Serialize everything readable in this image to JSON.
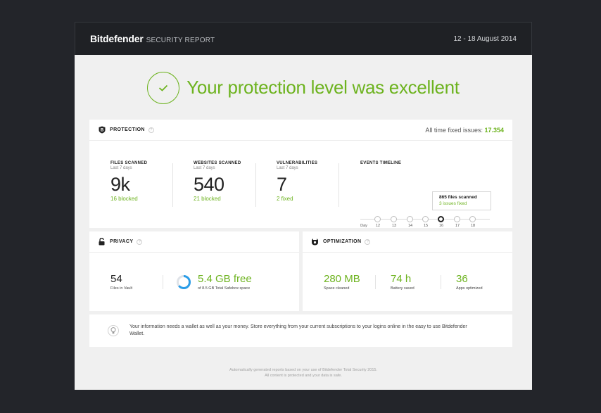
{
  "header": {
    "brand": "Bitdefender",
    "subtitle": "SECURITY REPORT",
    "date_range": "12 - 18 August 2014"
  },
  "hero": {
    "title": "Your protection level was excellent",
    "icon": "check-icon"
  },
  "protection": {
    "title": "PROTECTION",
    "help": "?",
    "fixed_label": "All time fixed issues:",
    "fixed_value": "17.354",
    "stats": [
      {
        "label": "FILES SCANNED",
        "sub": "Last 7 days",
        "value": "9k",
        "note": "16 blocked"
      },
      {
        "label": "WEBSITES SCANNED",
        "sub": "Last 7 days",
        "value": "540",
        "note": "21 blocked"
      },
      {
        "label": "VULNERABILITIES",
        "sub": "Last 7 days",
        "value": "7",
        "note": "2 fixed"
      }
    ],
    "timeline": {
      "label": "EVENTS TIMELINE",
      "tooltip_line1": "865 files scanned",
      "tooltip_line2": "3 issues fixed",
      "axis_label": "Day",
      "days": [
        "12",
        "13",
        "14",
        "15",
        "16",
        "17",
        "18"
      ],
      "active_day": "16"
    }
  },
  "privacy": {
    "title": "PRIVACY",
    "help": "?",
    "files_value": "54",
    "files_label": "Files in Vault",
    "space_value": "5.4 GB free",
    "space_label": "of 8.5 GB Total Safebox space",
    "used_fraction": 0.36
  },
  "optimization": {
    "title": "OPTIMIZATION",
    "help": "?",
    "stats": [
      {
        "value": "280 MB",
        "label": "Space cleaned"
      },
      {
        "value": "74 h",
        "label": "Battery saved"
      },
      {
        "value": "36",
        "label": "Apps optimized"
      }
    ]
  },
  "wallet": {
    "text": "Your information needs a wallet as well as your money. Store everything from your current subscriptions to your logins online in the easy to use Bitdefender Wallet."
  },
  "footer": {
    "line1": "Automatically generated reports based on your use of Bitdefender Total Security 2015.",
    "line2": "All content is protected and your data is safe."
  },
  "colors": {
    "accent": "#6db31f",
    "ring": "#2b9de8",
    "header_bg": "#1f2125",
    "page_bg": "#23252a"
  }
}
